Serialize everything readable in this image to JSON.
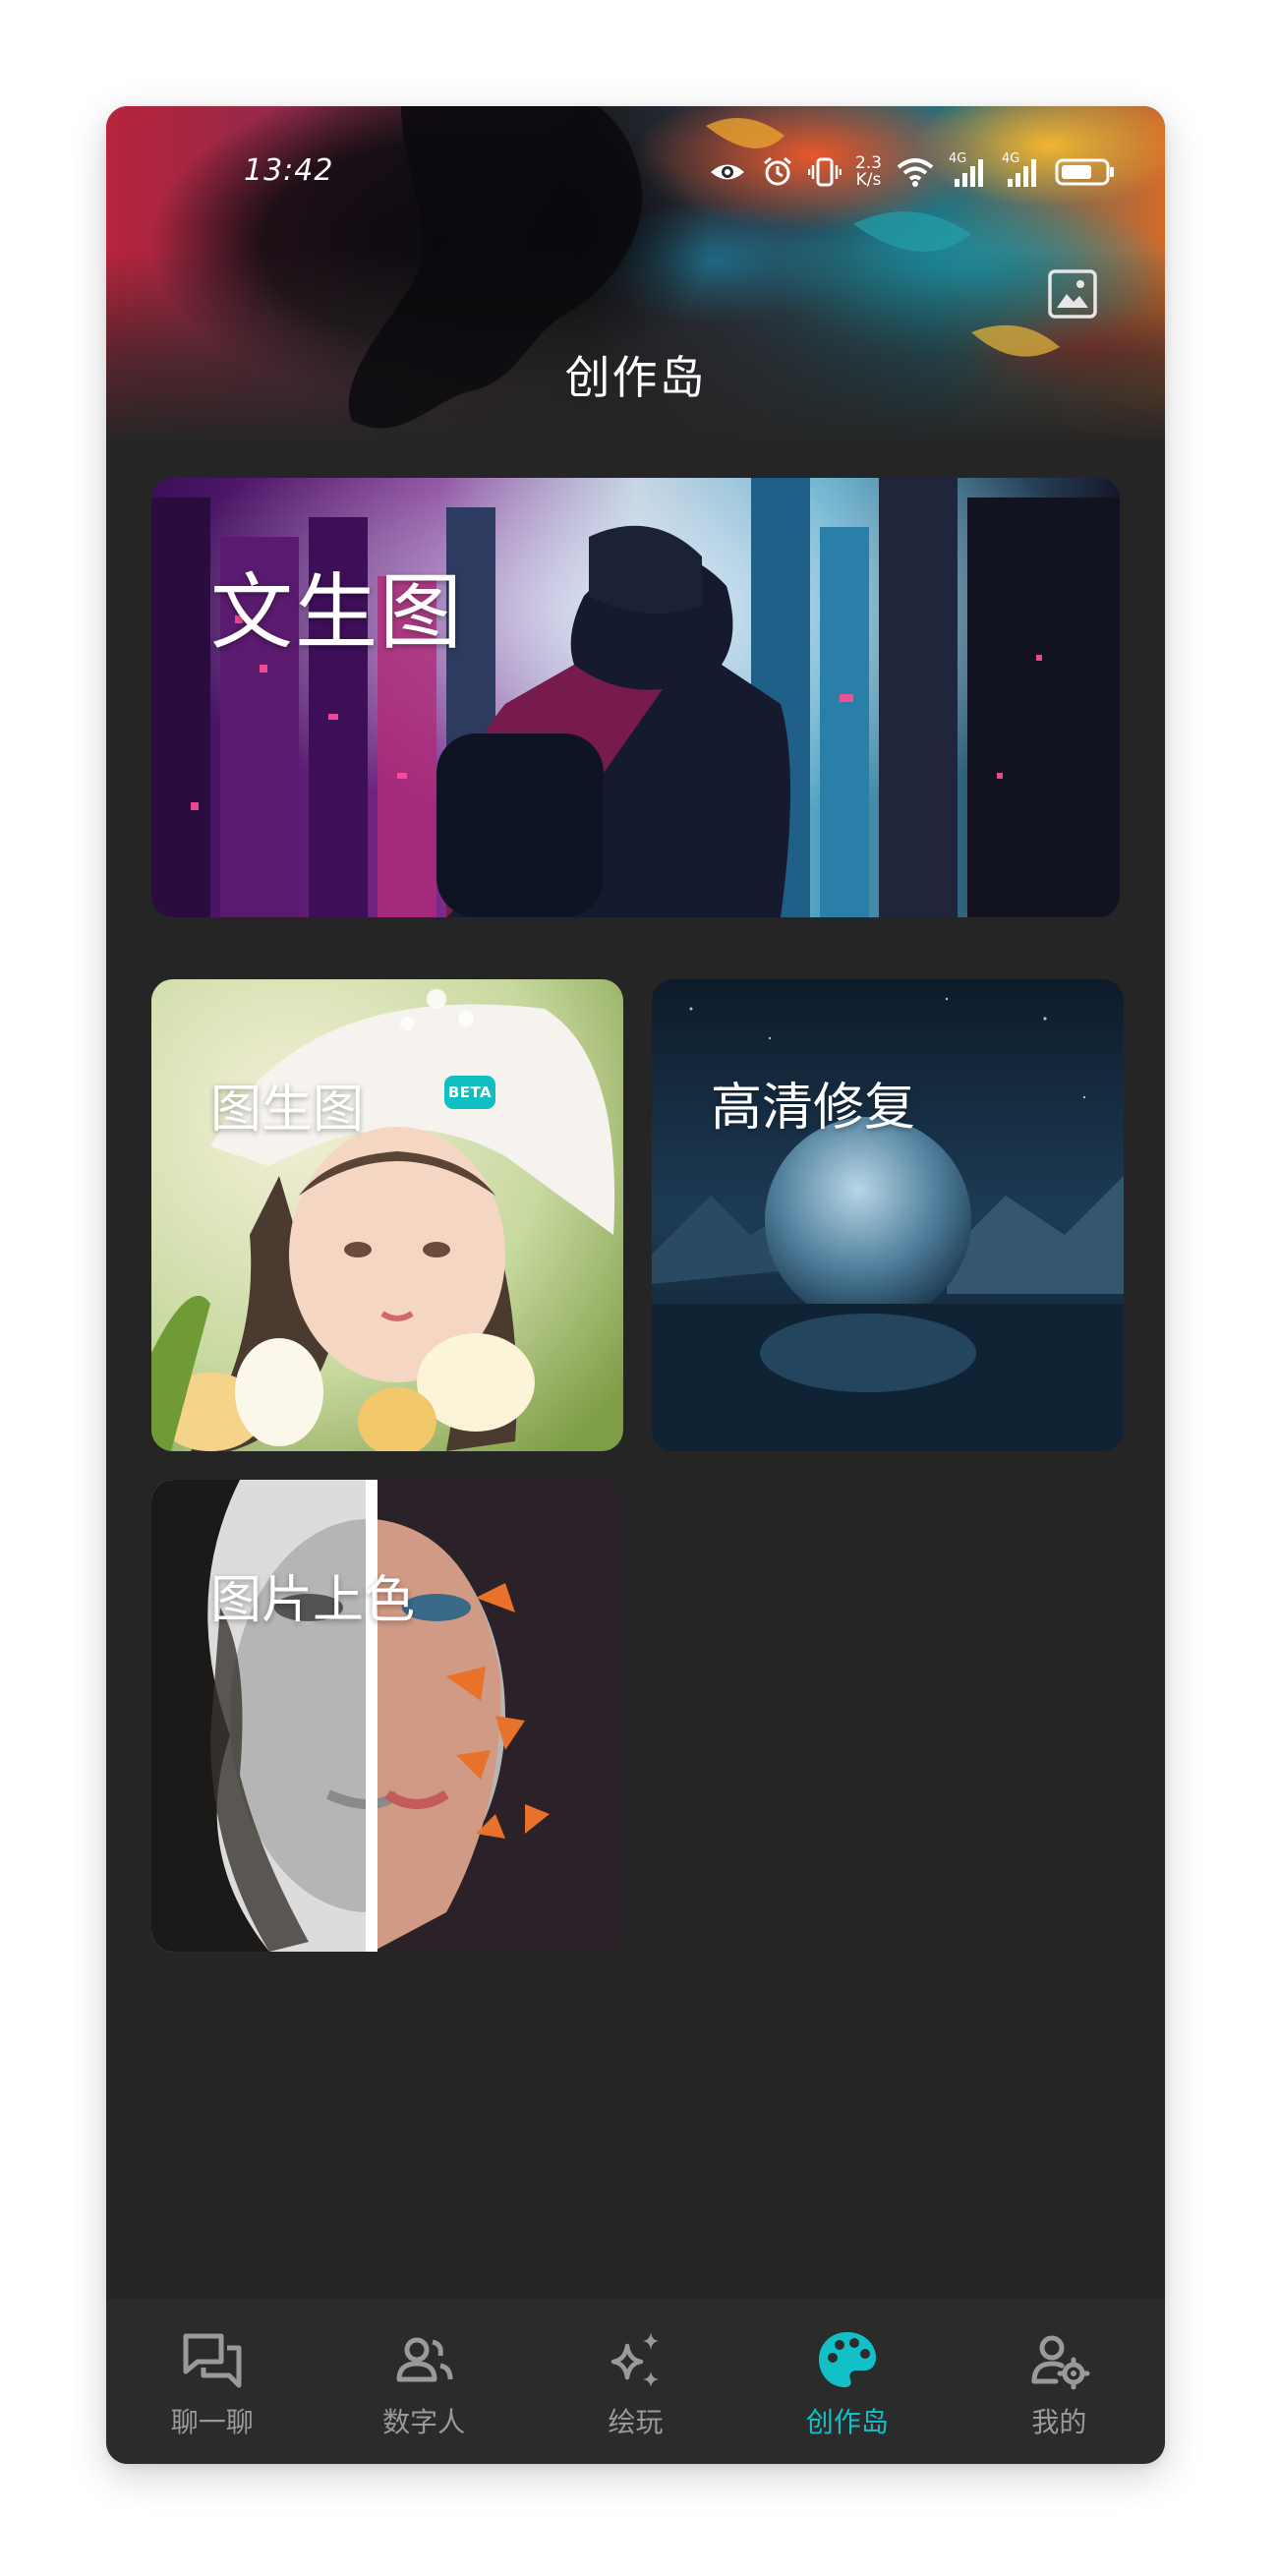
{
  "status_bar": {
    "time": "13:42",
    "net_speed_value": "2.3",
    "net_speed_unit": "K/s",
    "signal1_label": "4G",
    "signal2_label": "4G",
    "icons": [
      "eye-icon",
      "alarm-icon",
      "vibrate-icon",
      "wifi-icon",
      "signal-icon",
      "battery-icon"
    ]
  },
  "header": {
    "title": "创作岛",
    "gallery_icon": "gallery-icon"
  },
  "cards": {
    "text_to_image": {
      "label": "文生图"
    },
    "image_to_image": {
      "label": "图生图",
      "badge": "BETA"
    },
    "hd_restore": {
      "label": "高清修复"
    },
    "colorize": {
      "label": "图片上色"
    }
  },
  "bottom_nav": {
    "active_index": 3,
    "active_color": "#12c1c8",
    "items": [
      {
        "label": "聊一聊",
        "icon": "chat-icon"
      },
      {
        "label": "数字人",
        "icon": "people-icon"
      },
      {
        "label": "绘玩",
        "icon": "sparkle-icon"
      },
      {
        "label": "创作岛",
        "icon": "palette-icon"
      },
      {
        "label": "我的",
        "icon": "user-settings-icon"
      }
    ]
  }
}
